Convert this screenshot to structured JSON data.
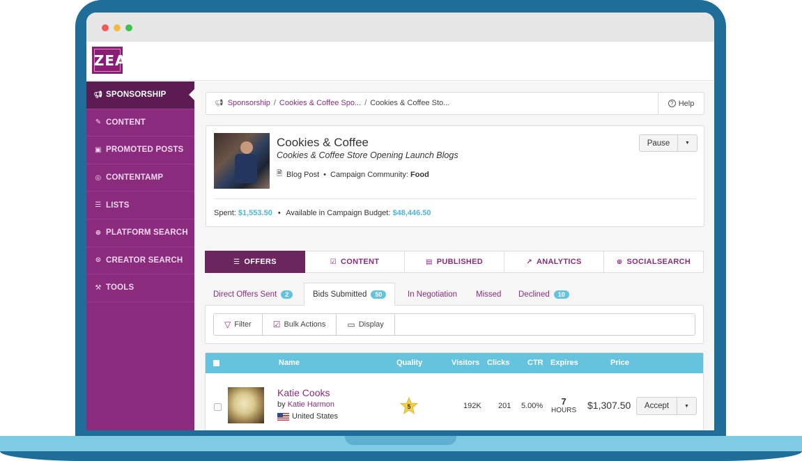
{
  "app": {
    "logo_text": "IZEA"
  },
  "sidebar": {
    "items": [
      {
        "label": "SPONSORSHIP",
        "icon": "megaphone-icon",
        "active": true
      },
      {
        "label": "CONTENT",
        "icon": "pencil-icon"
      },
      {
        "label": "PROMOTED POSTS",
        "icon": "promoted-icon"
      },
      {
        "label": "CONTENTAMP",
        "icon": "amp-icon"
      },
      {
        "label": "LISTS",
        "icon": "list-icon"
      },
      {
        "label": "PLATFORM SEARCH",
        "icon": "search-icon"
      },
      {
        "label": "CREATOR SEARCH",
        "icon": "creator-search-icon"
      },
      {
        "label": "TOOLS",
        "icon": "wrench-icon"
      }
    ]
  },
  "breadcrumb": {
    "crumb1": "Sponsorship",
    "crumb2": "Cookies & Coffee Spo...",
    "crumb3": "Cookies & Coffee Sto...",
    "separator": "/",
    "help": "Help"
  },
  "campaign": {
    "title": "Cookies & Coffee",
    "subtitle": "Cookies & Coffee Store Opening Launch Blogs",
    "type": "Blog Post",
    "community_label": "Campaign Community:",
    "community_value": "Food",
    "pause": "Pause",
    "spent_label": "Spent:",
    "spent_value": "$1,553.50",
    "budget_label": "Available in Campaign Budget:",
    "budget_value": "$48,446.50"
  },
  "main_tabs": [
    {
      "label": "OFFERS",
      "active": true
    },
    {
      "label": "CONTENT"
    },
    {
      "label": "PUBLISHED"
    },
    {
      "label": "ANALYTICS"
    },
    {
      "label": "SOCIALSEARCH"
    }
  ],
  "sub_tabs": [
    {
      "label": "Direct Offers Sent",
      "count": "2"
    },
    {
      "label": "Bids Submitted",
      "count": "50",
      "active": true
    },
    {
      "label": "In Negotiation"
    },
    {
      "label": "Missed"
    },
    {
      "label": "Declined",
      "count": "10"
    }
  ],
  "toolbar": {
    "filter": "Filter",
    "bulk": "Bulk Actions",
    "display": "Display"
  },
  "table": {
    "headers": {
      "name": "Name",
      "quality": "Quality",
      "visitors": "Visitors",
      "clicks": "Clicks",
      "ctr": "CTR",
      "expires": "Expires",
      "price": "Price"
    },
    "rows": [
      {
        "name": "Katie Cooks",
        "by_prefix": "by",
        "owner": "Katie Harmon",
        "country": "United States",
        "quality": "5",
        "visitors": "192K",
        "clicks": "201",
        "ctr": "5.00%",
        "expires_value": "7",
        "expires_unit": "HOURS",
        "price": "$1,307.50",
        "action": "Accept"
      }
    ]
  },
  "colors": {
    "brand": "#8b2b7e",
    "brand_dark": "#5c1c53",
    "accent": "#66c3de",
    "frame": "#1f6d99"
  }
}
